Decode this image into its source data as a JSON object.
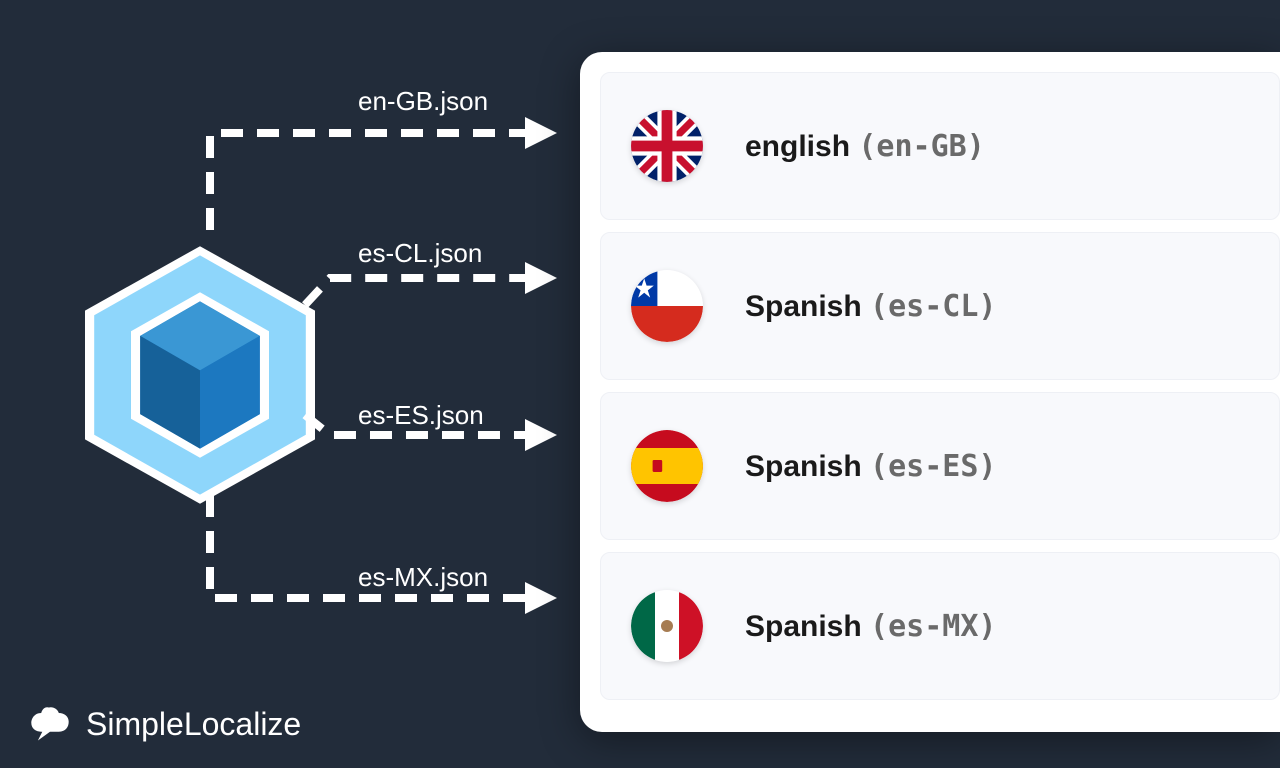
{
  "files": [
    {
      "name": "en-GB.json"
    },
    {
      "name": "es-CL.json"
    },
    {
      "name": "es-ES.json"
    },
    {
      "name": "es-MX.json"
    }
  ],
  "locales": [
    {
      "language": "english",
      "code": "en-GB",
      "flag": "gb"
    },
    {
      "language": "Spanish",
      "code": "es-CL",
      "flag": "cl"
    },
    {
      "language": "Spanish",
      "code": "es-ES",
      "flag": "es"
    },
    {
      "language": "Spanish",
      "code": "es-MX",
      "flag": "mx"
    }
  ],
  "brand": "SimpleLocalize"
}
